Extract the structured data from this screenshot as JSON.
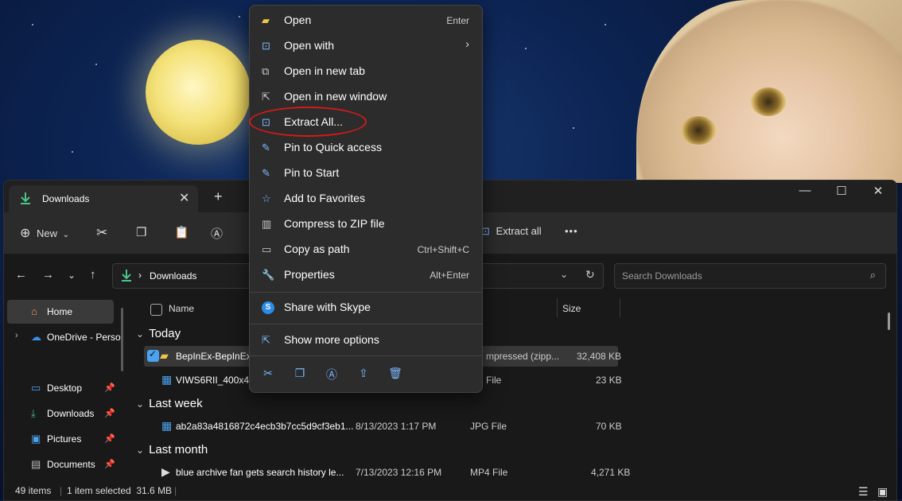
{
  "window": {
    "tab_title": "Downloads",
    "address": "Downloads",
    "search_placeholder": "Search Downloads"
  },
  "toolbar": {
    "new_label": "New",
    "extract_all_label": "Extract all",
    "more_label": "•••"
  },
  "sidebar": {
    "items": [
      {
        "label": "Home",
        "icon": "home-icon",
        "pinned": false
      },
      {
        "label": "OneDrive - Perso",
        "icon": "cloud-icon",
        "pinned": false
      },
      {
        "label": "Desktop",
        "icon": "desktop-icon",
        "pinned": true
      },
      {
        "label": "Downloads",
        "icon": "download-icon",
        "pinned": true
      },
      {
        "label": "Pictures",
        "icon": "pictures-icon",
        "pinned": true
      },
      {
        "label": "Documents",
        "icon": "documents-icon",
        "pinned": true
      }
    ]
  },
  "columns": {
    "name": "Name",
    "type": "e",
    "size": "Size"
  },
  "groups": [
    {
      "label": "Today",
      "files": [
        {
          "name": "BepInEx-BepInExP",
          "date": "",
          "type": "mpressed (zipp...",
          "size": "32,408 KB",
          "selected": true
        },
        {
          "name": "VIWS6RII_400x400",
          "date": "",
          "type": "File",
          "size": "23 KB",
          "selected": false
        }
      ]
    },
    {
      "label": "Last week",
      "files": [
        {
          "name": "ab2a83a4816872c4ecb3b7cc5d9cf3eb1...",
          "date": "8/13/2023 1:17 PM",
          "type": "JPG File",
          "size": "70 KB",
          "selected": false
        }
      ]
    },
    {
      "label": "Last month",
      "files": [
        {
          "name": "blue archive fan gets search history le...",
          "date": "7/13/2023 12:16 PM",
          "type": "MP4 File",
          "size": "4,271 KB",
          "selected": false
        }
      ]
    }
  ],
  "status": {
    "count": "49 items",
    "selection": "1 item selected  31.6 MB"
  },
  "context_menu": {
    "items": [
      {
        "label": "Open",
        "shortcut": "Enter",
        "icon": "folder-open-icon"
      },
      {
        "label": "Open with",
        "shortcut": "›",
        "icon": "open-with-icon"
      },
      {
        "label": "Open in new tab",
        "shortcut": "",
        "icon": "new-tab-icon"
      },
      {
        "label": "Open in new window",
        "shortcut": "",
        "icon": "new-window-icon"
      },
      {
        "label": "Extract All...",
        "shortcut": "",
        "icon": "extract-icon"
      },
      {
        "label": "Pin to Quick access",
        "shortcut": "",
        "icon": "pin-icon"
      },
      {
        "label": "Pin to Start",
        "shortcut": "",
        "icon": "pin-start-icon"
      },
      {
        "label": "Add to Favorites",
        "shortcut": "",
        "icon": "star-icon"
      },
      {
        "label": "Compress to ZIP file",
        "shortcut": "",
        "icon": "zip-icon"
      },
      {
        "label": "Copy as path",
        "shortcut": "Ctrl+Shift+C",
        "icon": "copy-path-icon"
      },
      {
        "label": "Properties",
        "shortcut": "Alt+Enter",
        "icon": "wrench-icon"
      },
      {
        "label": "Share with Skype",
        "shortcut": "",
        "icon": "skype-icon"
      },
      {
        "label": "Show more options",
        "shortcut": "",
        "icon": "more-options-icon"
      }
    ],
    "highlight_color": "#d31a1a"
  }
}
